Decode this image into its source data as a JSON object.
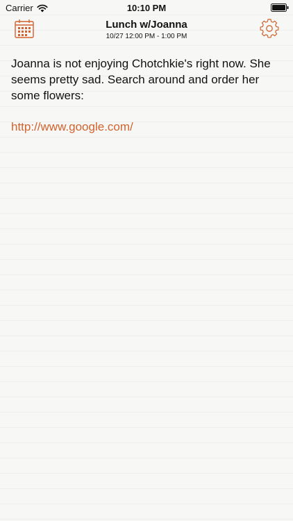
{
  "status_bar": {
    "carrier": "Carrier",
    "time": "10:10 PM",
    "wifi_icon": "wifi-icon",
    "battery_icon": "battery-icon"
  },
  "nav": {
    "title": "Lunch w/Joanna",
    "subtitle": "10/27 12:00 PM - 1:00 PM",
    "left_icon": "calendar-icon",
    "right_icon": "gear-icon",
    "accent_color": "#d2622d"
  },
  "note": {
    "text": "Joanna is not enjoying Chotchkie's right now. She seems pretty sad. Search around and order her some flowers:",
    "link": "http://www.google.com/",
    "link_color": "#d2622d"
  }
}
